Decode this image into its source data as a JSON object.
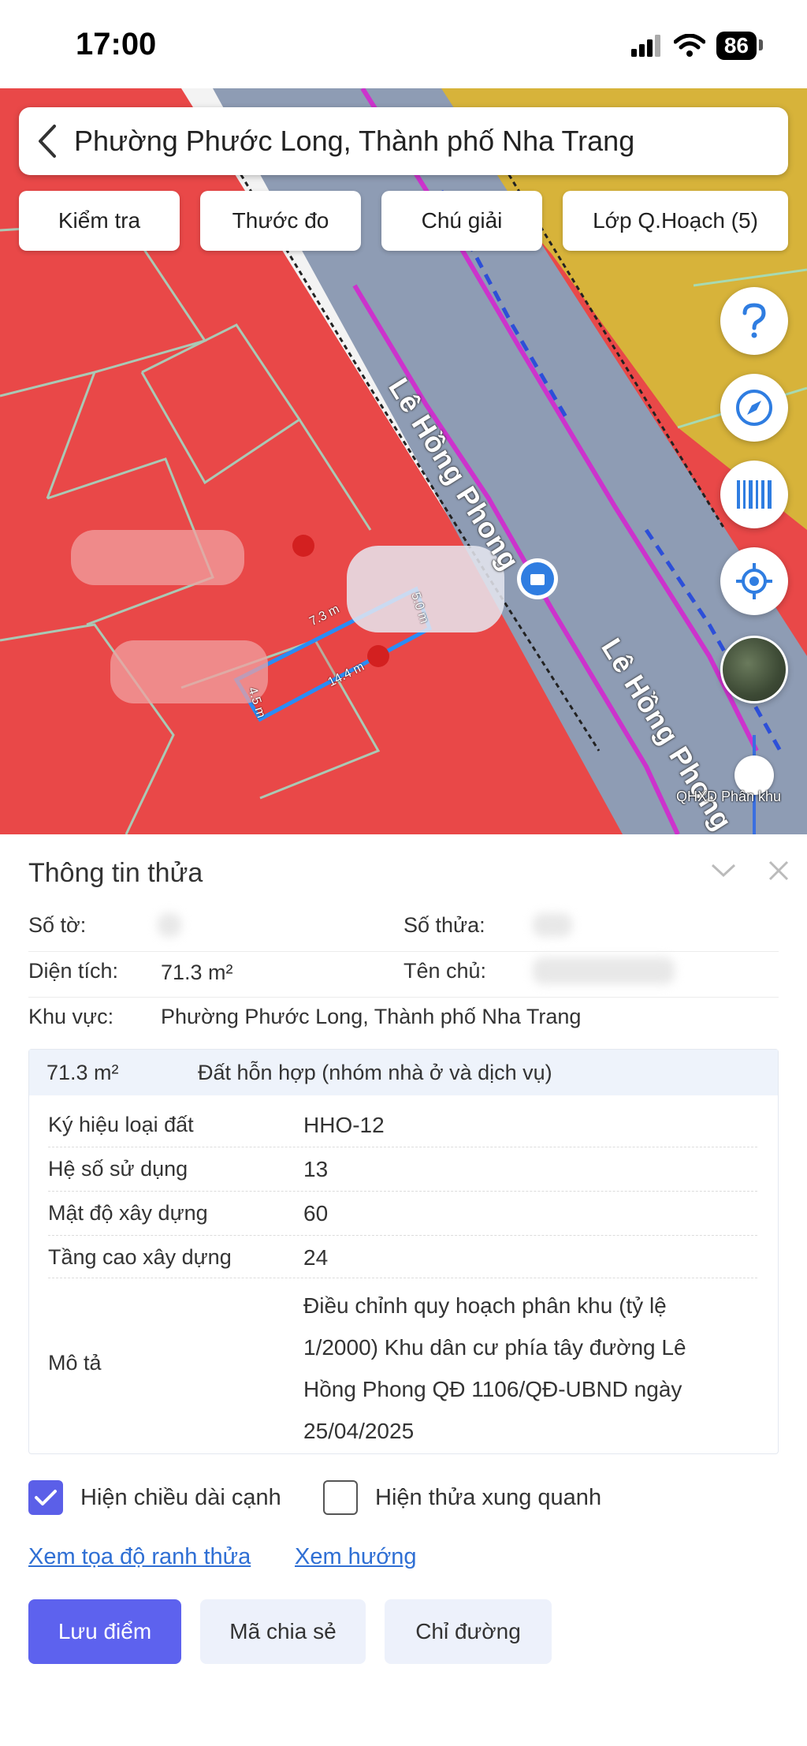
{
  "status_bar": {
    "time": "17:00",
    "battery": "86"
  },
  "search": {
    "title": "Phường Phước Long, Thành phố Nha Trang"
  },
  "toolbar": [
    {
      "id": "check",
      "label": "Kiểm tra"
    },
    {
      "id": "ruler",
      "label": "Thước đo"
    },
    {
      "id": "legend",
      "label": "Chú giải"
    },
    {
      "id": "layers",
      "label": "Lớp Q.Hoạch (5)"
    }
  ],
  "map": {
    "street_name": "Lê Hồng Phong",
    "layer_slider_label": "QHXD Phân khu",
    "measurements": [
      "7.3 m",
      "5.0 m",
      "14.4 m",
      "4.5 m"
    ]
  },
  "panel": {
    "title": "Thông tin thửa",
    "fields": {
      "sheet_label": "Số tờ:",
      "parcel_label": "Số thửa:",
      "area_label": "Diện tích:",
      "area_value": "71.3 m²",
      "owner_label": "Tên chủ:",
      "region_label": "Khu vực:",
      "region_value": "Phường Phước Long, Thành phố Nha Trang"
    },
    "land": {
      "area": "71.3 m²",
      "type": "Đất hỗn hợp (nhóm nhà ở và dịch vụ)",
      "rows": [
        {
          "label": "Ký hiệu loại đất",
          "value": "HHO-12"
        },
        {
          "label": "Hệ số sử dụng",
          "value": "13"
        },
        {
          "label": "Mật độ xây dựng",
          "value": "60"
        },
        {
          "label": "Tầng cao xây dựng",
          "value": "24"
        }
      ],
      "desc_label": "Mô tả",
      "desc_lines": [
        "Điều chỉnh quy hoạch phân khu (tỷ lệ",
        "1/2000) Khu dân cư phía tây đường Lê",
        "Hồng Phong QĐ 1106/QĐ-UBND ngày",
        "25/04/2025"
      ]
    },
    "checks": {
      "show_edges": "Hiện chiều dài cạnh",
      "show_neighbors": "Hiện thửa xung quanh"
    },
    "links": {
      "coords": "Xem tọa độ ranh thửa",
      "direction": "Xem hướng"
    },
    "buttons": {
      "save": "Lưu điểm",
      "share": "Mã chia sẻ",
      "route": "Chỉ đường"
    }
  },
  "colors": {
    "accent": "#5d62ee",
    "map_red": "#e94848",
    "map_yellow": "#d7b33a",
    "road": "#8e9cb4"
  }
}
